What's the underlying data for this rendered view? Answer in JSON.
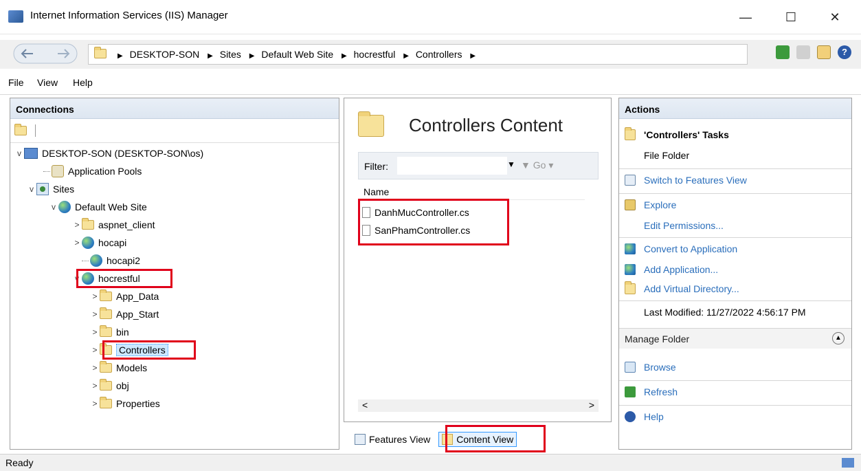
{
  "window": {
    "title": "Internet Information Services (IIS) Manager",
    "minimize": "—",
    "maximize": "☐",
    "close": "✕"
  },
  "breadcrumb": [
    "DESKTOP-SON",
    "Sites",
    "Default Web Site",
    "hocrestful",
    "Controllers"
  ],
  "menu": {
    "file": "File",
    "view": "View",
    "help": "Help"
  },
  "connections": {
    "header": "Connections",
    "tree": [
      {
        "label": "DESKTOP-SON (DESKTOP-SON\\os)"
      },
      {
        "label": "Application Pools"
      },
      {
        "label": "Sites"
      },
      {
        "label": "Default Web Site"
      },
      {
        "label": "aspnet_client"
      },
      {
        "label": "hocapi"
      },
      {
        "label": "hocapi2"
      },
      {
        "label": "hocrestful"
      },
      {
        "label": "App_Data"
      },
      {
        "label": "App_Start"
      },
      {
        "label": "bin"
      },
      {
        "label": "Controllers"
      },
      {
        "label": "Models"
      },
      {
        "label": "obj"
      },
      {
        "label": "Properties"
      }
    ]
  },
  "content": {
    "title": "Controllers Content",
    "filter_label": "Filter:",
    "go_label": "Go",
    "column_name": "Name",
    "files": [
      "DanhMucController.cs",
      "SanPhamController.cs"
    ]
  },
  "view_tabs": {
    "features": "Features View",
    "content": "Content View"
  },
  "actions": {
    "header": "Actions",
    "tasks_title": "'Controllers' Tasks",
    "file_folder": "File Folder",
    "switch": "Switch to Features View",
    "explore": "Explore",
    "edit_permissions": "Edit Permissions...",
    "convert": "Convert to Application",
    "add_application": "Add Application...",
    "add_vdir": "Add Virtual Directory...",
    "last_modified": "Last Modified: 11/27/2022 4:56:17 PM",
    "manage_folder": "Manage Folder",
    "browse": "Browse",
    "refresh": "Refresh",
    "help": "Help"
  },
  "status": {
    "text": "Ready"
  },
  "colors": {
    "link": "#2a6ebb",
    "highlight_box": "#e0001a",
    "selection": "#cce8ff"
  }
}
